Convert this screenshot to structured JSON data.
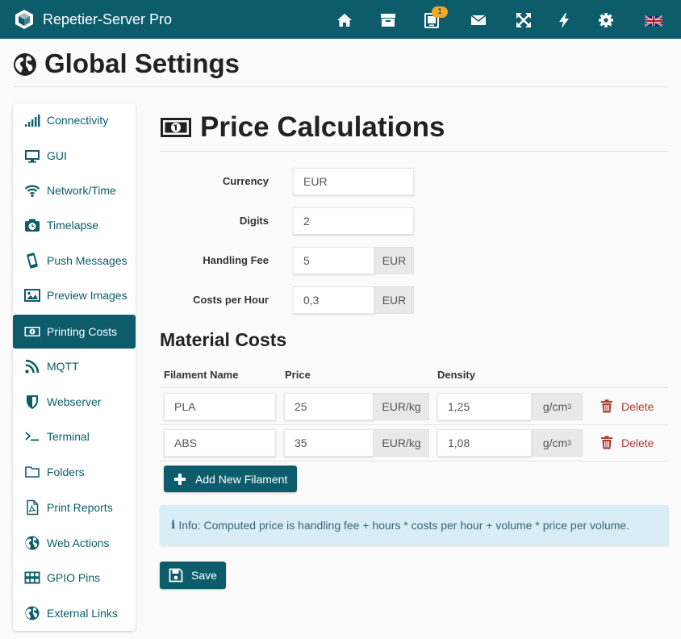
{
  "navbar": {
    "app_title": "Repetier-Server Pro",
    "icons": [
      "logo-icon",
      "home-icon",
      "archive-icon",
      "printer-tablet-icon",
      "envelope-icon",
      "expand-icon",
      "bolt-icon",
      "gear-icon",
      "uk-flag-icon"
    ],
    "notification_count": "1",
    "badge_color": "#f0a82a",
    "background_color": "#0c5c6b"
  },
  "page": {
    "title": "Global Settings",
    "title_icon": "globe-icon"
  },
  "sidebar": {
    "items": [
      {
        "label": "Connectivity",
        "icon": "signal-icon"
      },
      {
        "label": "GUI",
        "icon": "monitor-icon"
      },
      {
        "label": "Network/Time",
        "icon": "wifi-icon"
      },
      {
        "label": "Timelapse",
        "icon": "camera-icon"
      },
      {
        "label": "Push Messages",
        "icon": "mobile-icon"
      },
      {
        "label": "Preview Images",
        "icon": "image-icon"
      },
      {
        "label": "Printing Costs",
        "icon": "money-icon",
        "active": true
      },
      {
        "label": "MQTT",
        "icon": "rss-icon"
      },
      {
        "label": "Webserver",
        "icon": "shield-icon"
      },
      {
        "label": "Terminal",
        "icon": "terminal-icon"
      },
      {
        "label": "Folders",
        "icon": "folder-icon"
      },
      {
        "label": "Print Reports",
        "icon": "pdf-icon"
      },
      {
        "label": "Web Actions",
        "icon": "globe-icon"
      },
      {
        "label": "GPIO Pins",
        "icon": "grid-icon"
      },
      {
        "label": "External Links",
        "icon": "globe-icon"
      }
    ]
  },
  "content": {
    "title": "Price Calculations",
    "title_icon": "money-icon",
    "fields": {
      "currency": {
        "label": "Currency",
        "value": "EUR"
      },
      "digits": {
        "label": "Digits",
        "value": "2"
      },
      "handling_fee": {
        "label": "Handling Fee",
        "value": "5",
        "unit": "EUR"
      },
      "costs_per_hour": {
        "label": "Costs per Hour",
        "value": "0,3",
        "unit": "EUR"
      }
    },
    "material_costs": {
      "title": "Material Costs",
      "columns": [
        "Filament Name",
        "Price",
        "Density"
      ],
      "rows": [
        {
          "name": "PLA",
          "price": "25",
          "price_unit": "EUR/kg",
          "density": "1,25",
          "density_unit": "g/cm",
          "density_sup": "3",
          "delete_label": "Delete"
        },
        {
          "name": "ABS",
          "price": "35",
          "price_unit": "EUR/kg",
          "density": "1,08",
          "density_unit": "g/cm",
          "density_sup": "3",
          "delete_label": "Delete"
        }
      ],
      "add_button_label": "Add New Filament"
    },
    "info_text": "Info: Computed price is handling fee + hours * costs per hour + volume * price per volume.",
    "save_label": "Save"
  }
}
